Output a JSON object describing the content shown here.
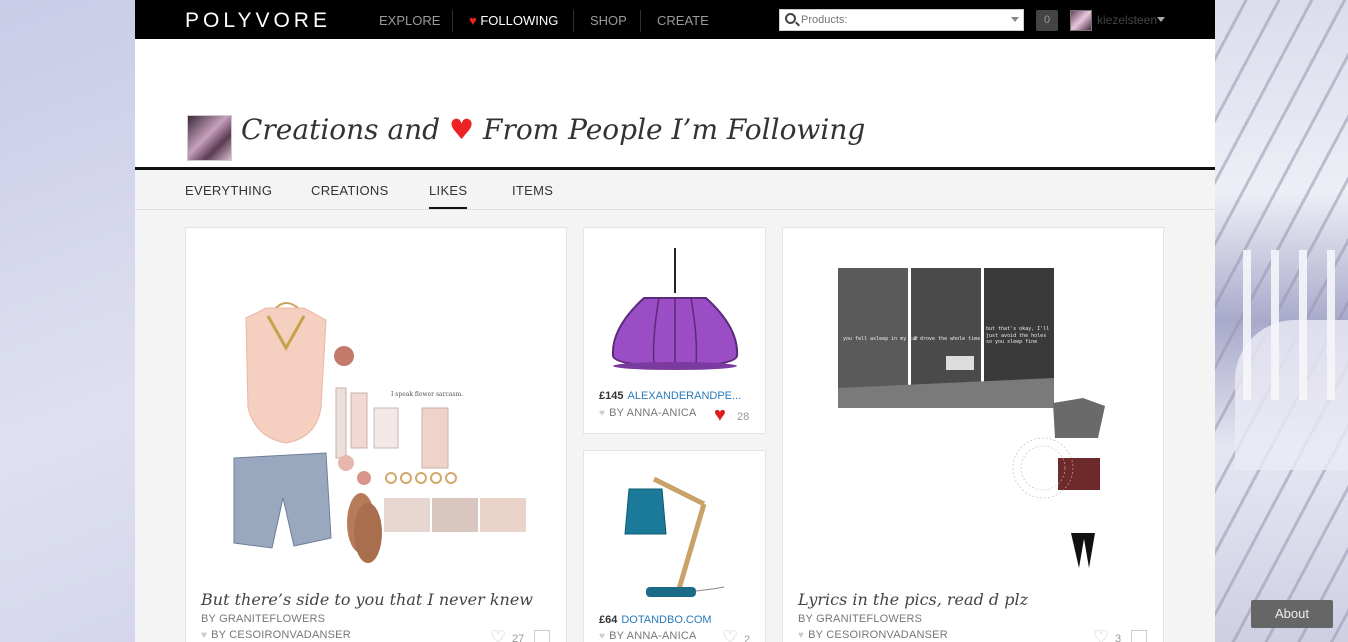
{
  "topbar": {
    "logo": "POLYVORE",
    "nav": {
      "explore": "EXPLORE",
      "following": "FOLLOWING",
      "shop": "SHOP",
      "create": "CREATE"
    },
    "search_placeholder": "Products:",
    "notification_count": "0",
    "username": "kiezelsteen"
  },
  "header": {
    "title_part1": "Creations and",
    "title_part2": "From People I’m Following"
  },
  "tabs": {
    "everything": "EVERYTHING",
    "creations": "CREATIONS",
    "likes": "LIKES",
    "items": "ITEMS"
  },
  "feed": [
    {
      "caption": "But there’s side to you that I never knew",
      "by": "BY GRANITEFLOWERS",
      "liked_by": "BY CESOIRONVADANSER",
      "likes": "27"
    },
    {
      "price": "£145",
      "store": "ALEXANDERANDPE...",
      "liked_by": "BY ANNA-ANICA",
      "likes": "28"
    },
    {
      "price": "£64",
      "store": "DOTANDBO.COM",
      "liked_by": "BY ANNA-ANICA",
      "likes": "2"
    },
    {
      "caption": "Lyrics in the pics, read d plz",
      "by": "BY GRANITEFLOWERS",
      "liked_by": "BY CESOIRONVADANSER",
      "likes": "3"
    }
  ],
  "collage_text": {
    "img_text": "I speak flower sarcasm.",
    "panel1": "you fell asleep in my car",
    "panel2": "I drove the whole time",
    "panel3": "but that's okay, I'll just avoid the holes so you sleep fine"
  },
  "about": "About",
  "colors": {
    "accent": "#e22222",
    "link": "#2a7ab8",
    "purple_lamp": "#9b4dc6",
    "teal_lamp": "#1b7a9a"
  }
}
